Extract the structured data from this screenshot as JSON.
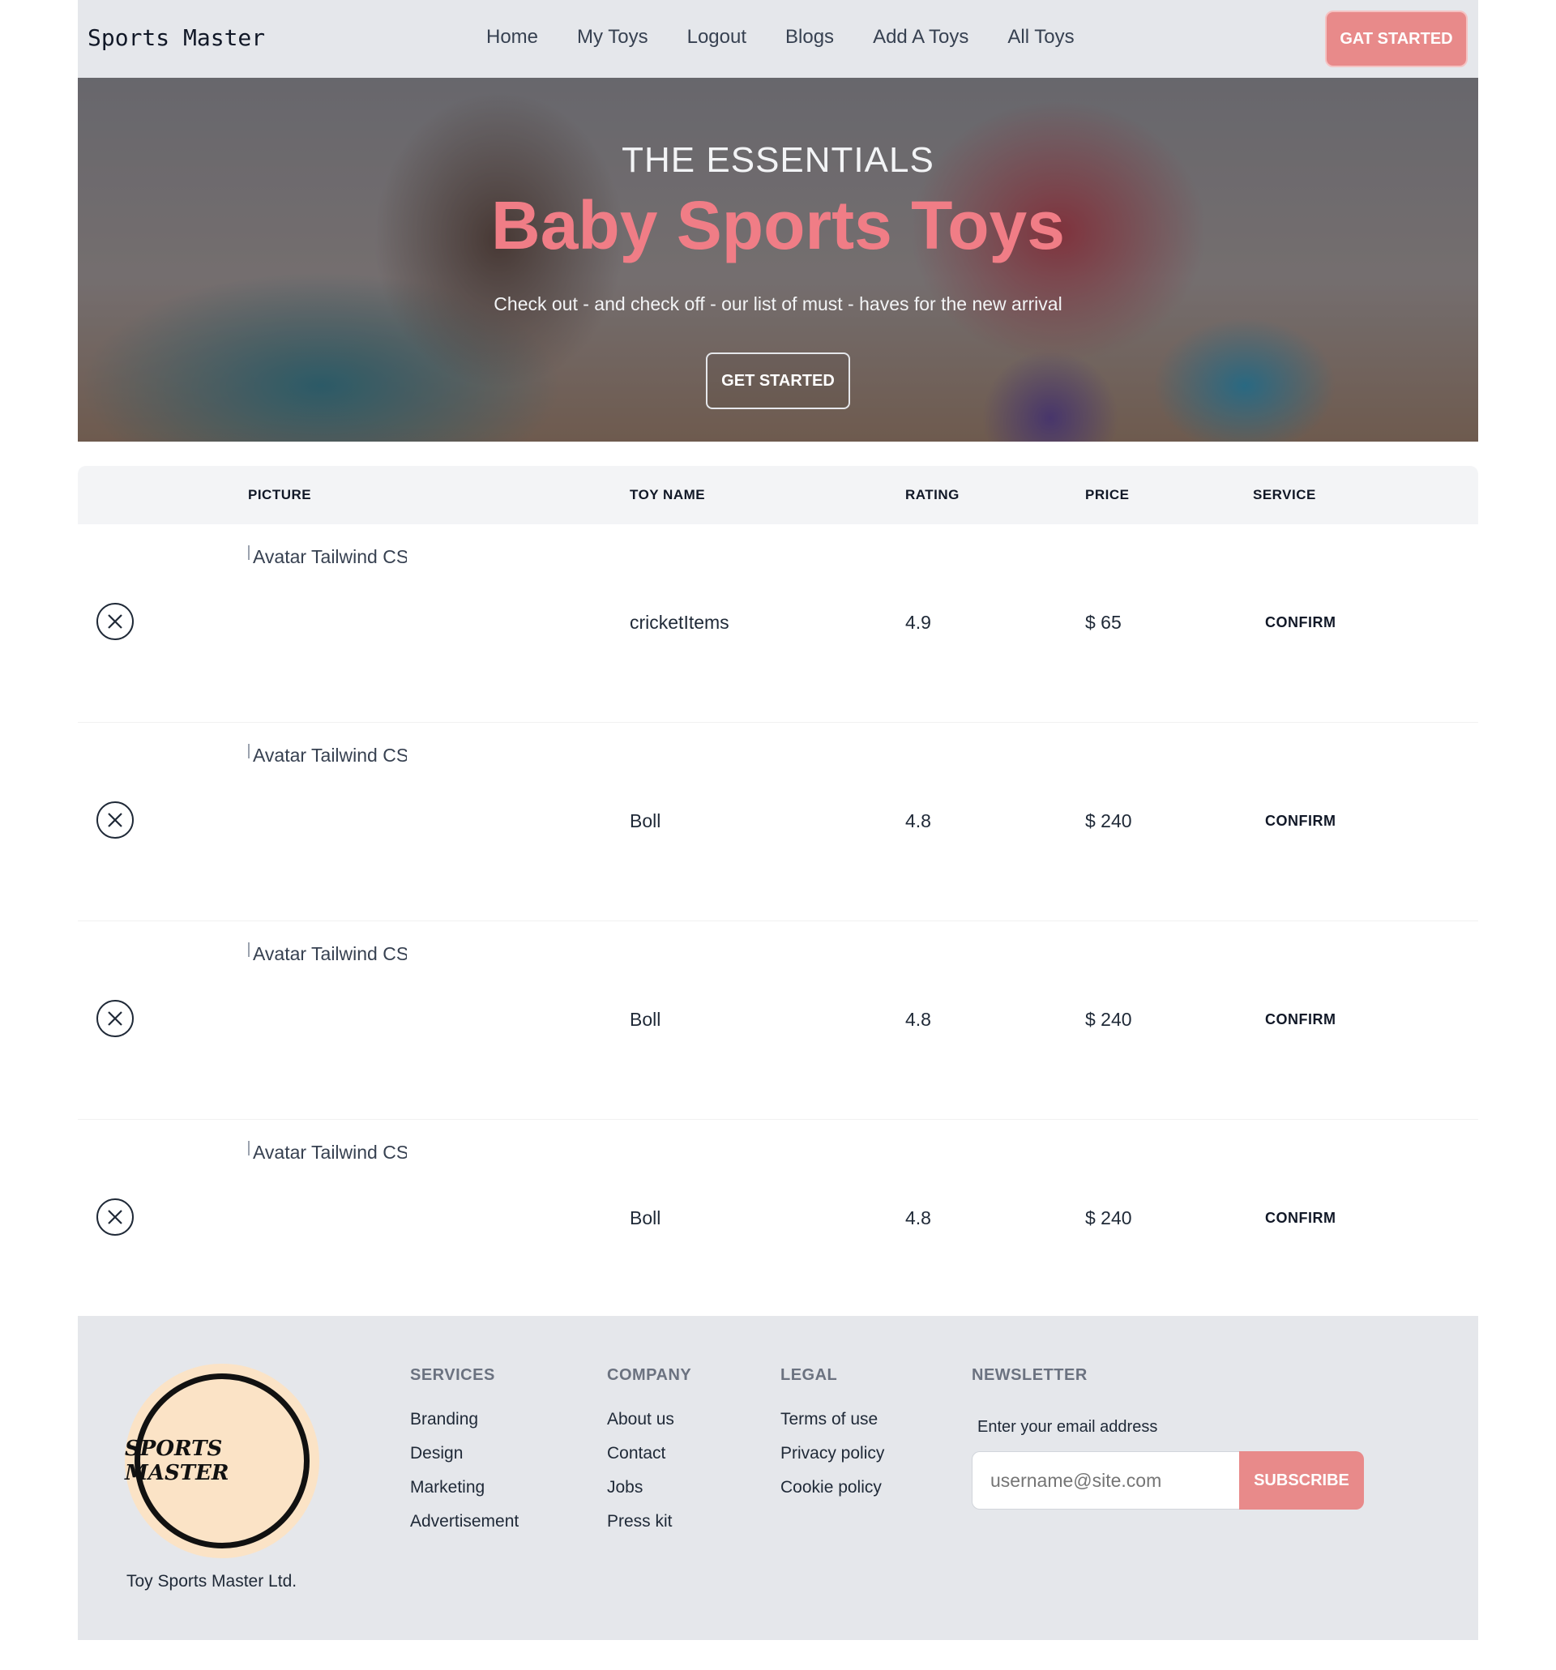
{
  "navbar": {
    "brand": "Sports Master",
    "links": [
      "Home",
      "My Toys",
      "Logout",
      "Blogs",
      "Add A Toys",
      "All Toys"
    ],
    "cta": "GAT STARTED"
  },
  "hero": {
    "eyebrow": "THE ESSENTIALS",
    "headline": "Baby Sports Toys",
    "subtitle": "Check out - and check off - our list of must - haves for the new arrival",
    "button": "GET STARTED"
  },
  "table": {
    "headers": [
      "PICTURE",
      "TOY NAME",
      "RATING",
      "PRICE",
      "SERVICE"
    ],
    "rows": [
      {
        "img_alt": "Avatar Tailwind CSS Component",
        "name": "cricketItems",
        "rating": "4.9",
        "price": "$ 65",
        "action": "CONFIRM"
      },
      {
        "img_alt": "Avatar Tailwind CSS Component",
        "name": "Boll",
        "rating": "4.8",
        "price": "$ 240",
        "action": "CONFIRM"
      },
      {
        "img_alt": "Avatar Tailwind CSS Component",
        "name": "Boll",
        "rating": "4.8",
        "price": "$ 240",
        "action": "CONFIRM"
      },
      {
        "img_alt": "Avatar Tailwind CSS Component",
        "name": "Boll",
        "rating": "4.8",
        "price": "$ 240",
        "action": "CONFIRM"
      }
    ]
  },
  "footer": {
    "logo_text": "SPORTS MASTER",
    "company": "Toy Sports Master Ltd.",
    "columns": [
      {
        "title": "SERVICES",
        "links": [
          "Branding",
          "Design",
          "Marketing",
          "Advertisement"
        ]
      },
      {
        "title": "COMPANY",
        "links": [
          "About us",
          "Contact",
          "Jobs",
          "Press kit"
        ]
      },
      {
        "title": "LEGAL",
        "links": [
          "Terms of use",
          "Privacy policy",
          "Cookie policy"
        ]
      }
    ],
    "newsletter": {
      "title": "NEWSLETTER",
      "label": "Enter your email address",
      "placeholder": "username@site.com",
      "button": "SUBSCRIBE"
    }
  },
  "colors": {
    "accent": "#e88a8a",
    "headline": "#f07d86",
    "nav_bg": "#e5e7eb",
    "logo_bg": "#fbe3c6"
  },
  "icons": {
    "remove": "close-icon",
    "broken_image": "broken-image-icon"
  }
}
